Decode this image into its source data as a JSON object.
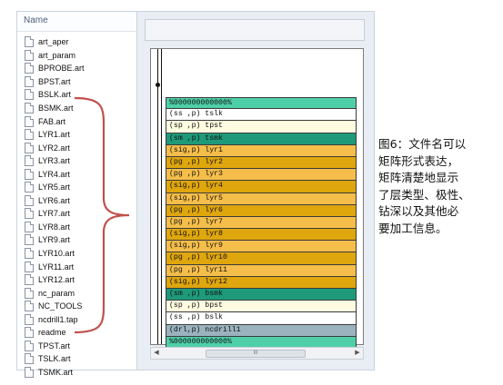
{
  "file_panel": {
    "header": "Name",
    "files": [
      "art_aper",
      "art_param",
      "BPROBE.art",
      "BPST.art",
      "BSLK.art",
      "BSMK.art",
      "FAB.art",
      "LYR1.art",
      "LYR2.art",
      "LYR3.art",
      "LYR4.art",
      "LYR5.art",
      "LYR6.art",
      "LYR7.art",
      "LYR8.art",
      "LYR9.art",
      "LYR10.art",
      "LYR11.art",
      "LYR12.art",
      "nc_param",
      "NC_TOOLS",
      "ncdrill1.tap",
      "readme",
      "TPST.art",
      "TSLK.art",
      "TSMK.art"
    ]
  },
  "layers": [
    {
      "text": "%000000000000%",
      "color": "#4fcfa8"
    },
    {
      "text": "(ss ,p) tslk",
      "color": "#ffffff"
    },
    {
      "text": "(sp ,p) tpst",
      "color": "#fffbe0"
    },
    {
      "text": "(sm ,p) tsmk",
      "color": "#1e9a7a"
    },
    {
      "text": "(sig,p) lyr1",
      "color": "#f5be4a"
    },
    {
      "text": "(pg ,p) lyr2",
      "color": "#dfa60e"
    },
    {
      "text": "(pg ,p) lyr3",
      "color": "#f5be4a"
    },
    {
      "text": "(sig,p) lyr4",
      "color": "#dfa60e"
    },
    {
      "text": "(sig,p) lyr5",
      "color": "#f5be4a"
    },
    {
      "text": "(pg ,p) lyr6",
      "color": "#dfa60e"
    },
    {
      "text": "(pg ,p) lyr7",
      "color": "#f5be4a"
    },
    {
      "text": "(sig,p) lyr8",
      "color": "#dfa60e"
    },
    {
      "text": "(sig,p) lyr9",
      "color": "#f5be4a"
    },
    {
      "text": "(pg ,p) lyr10",
      "color": "#dfa60e"
    },
    {
      "text": "(pg ,p) lyr11",
      "color": "#f5be4a"
    },
    {
      "text": "(sig,p) lyr12",
      "color": "#dfa60e"
    },
    {
      "text": "(sm ,p) bsmk",
      "color": "#1e9a7a"
    },
    {
      "text": "(sp ,p) bpst",
      "color": "#fffbe0"
    },
    {
      "text": "(ss ,p) bslk",
      "color": "#ffffff"
    },
    {
      "text": "(drl,p) ncdrill1",
      "color": "#9ab3bf"
    },
    {
      "text": "%000000000000%",
      "color": "#4fcfa8"
    }
  ],
  "scroll": {
    "left_arrow": "◀",
    "right_arrow": "▶",
    "grip": "III"
  },
  "caption": {
    "lines": [
      "图6：文件名可以",
      "矩阵形式表达，",
      "矩阵清楚地显示",
      "了层类型、极性、",
      "钻深以及其他必",
      "要加工信息。"
    ]
  },
  "colors": {
    "brace": "#c0504d"
  }
}
